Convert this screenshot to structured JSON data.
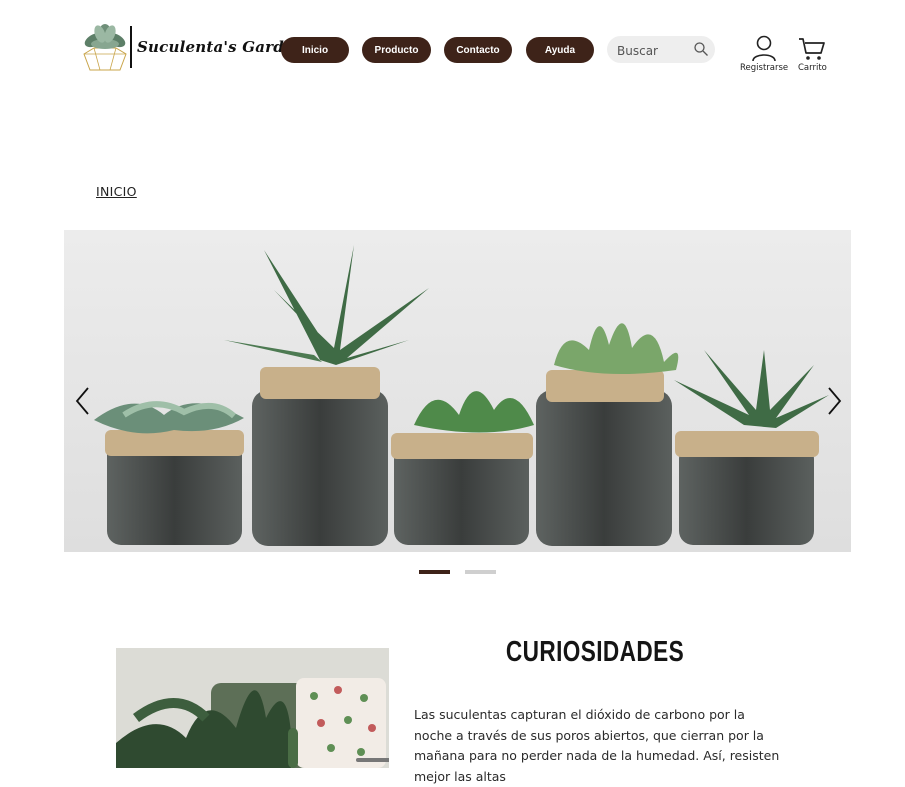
{
  "brand": {
    "name": "Suculenta's Garden"
  },
  "nav": [
    {
      "label": "Inicio"
    },
    {
      "label": "Producto"
    },
    {
      "label": "Contacto"
    },
    {
      "label": "Ayuda"
    }
  ],
  "search": {
    "placeholder": "Buscar",
    "icon": "search-icon"
  },
  "account": {
    "register_label": "Registrarse",
    "cart_label": "Carrito"
  },
  "breadcrumb": {
    "label": "INICIO"
  },
  "carousel": {
    "slide_count": 2,
    "active_index": 0
  },
  "curiosidades": {
    "title": "CURIOSIDADES",
    "text": "Las suculentas capturan el dióxido de carbono por la noche a través de sus poros abiertos, que cierran por la mañana para no perder nada de la humedad. Así, resisten mejor las altas"
  },
  "colors": {
    "accent": "#3e2319",
    "inactive_dot": "#cfcfcf",
    "search_bg": "#eeeeee"
  }
}
